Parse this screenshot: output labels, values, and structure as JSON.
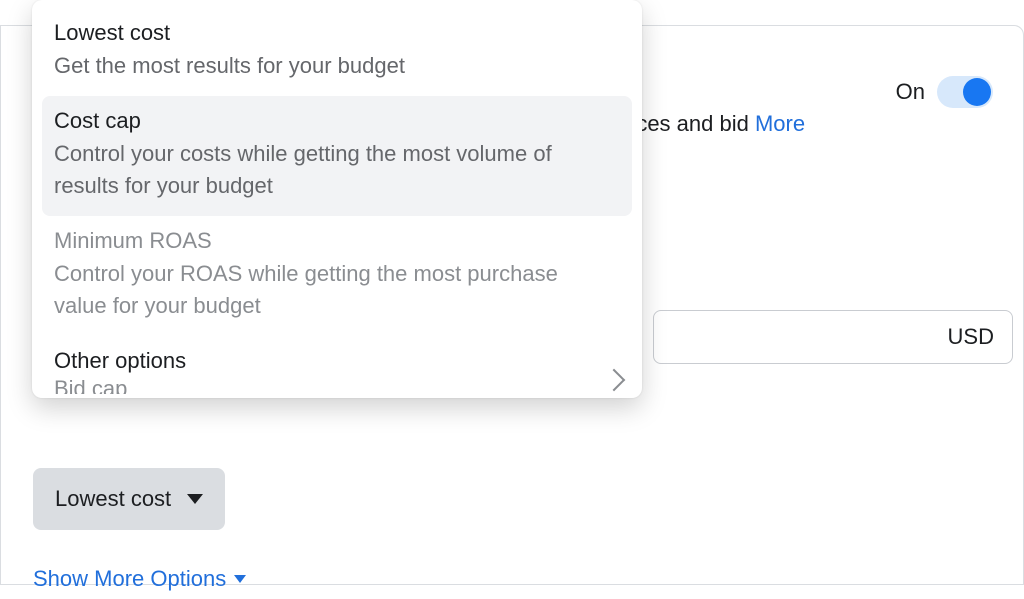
{
  "toggle": {
    "label": "On"
  },
  "section_text": {
    "line_visible": "t across ad sets to choices and bid",
    "learn_more": "More"
  },
  "currency": "USD",
  "bid_button": {
    "label": "Lowest cost"
  },
  "show_more": "Show More Options",
  "dropdown": {
    "items": [
      {
        "title": "Lowest cost",
        "desc": "Get the most results for your budget",
        "selected": false,
        "disabled": false
      },
      {
        "title": "Cost cap",
        "desc": "Control your costs while getting the most volume of results for your budget",
        "selected": true,
        "disabled": false
      },
      {
        "title": "Minimum ROAS",
        "desc": "Control your ROAS while getting the most purchase value for your budget",
        "selected": false,
        "disabled": true
      }
    ],
    "other": {
      "title": "Other options",
      "sub": "Bid cap"
    }
  }
}
